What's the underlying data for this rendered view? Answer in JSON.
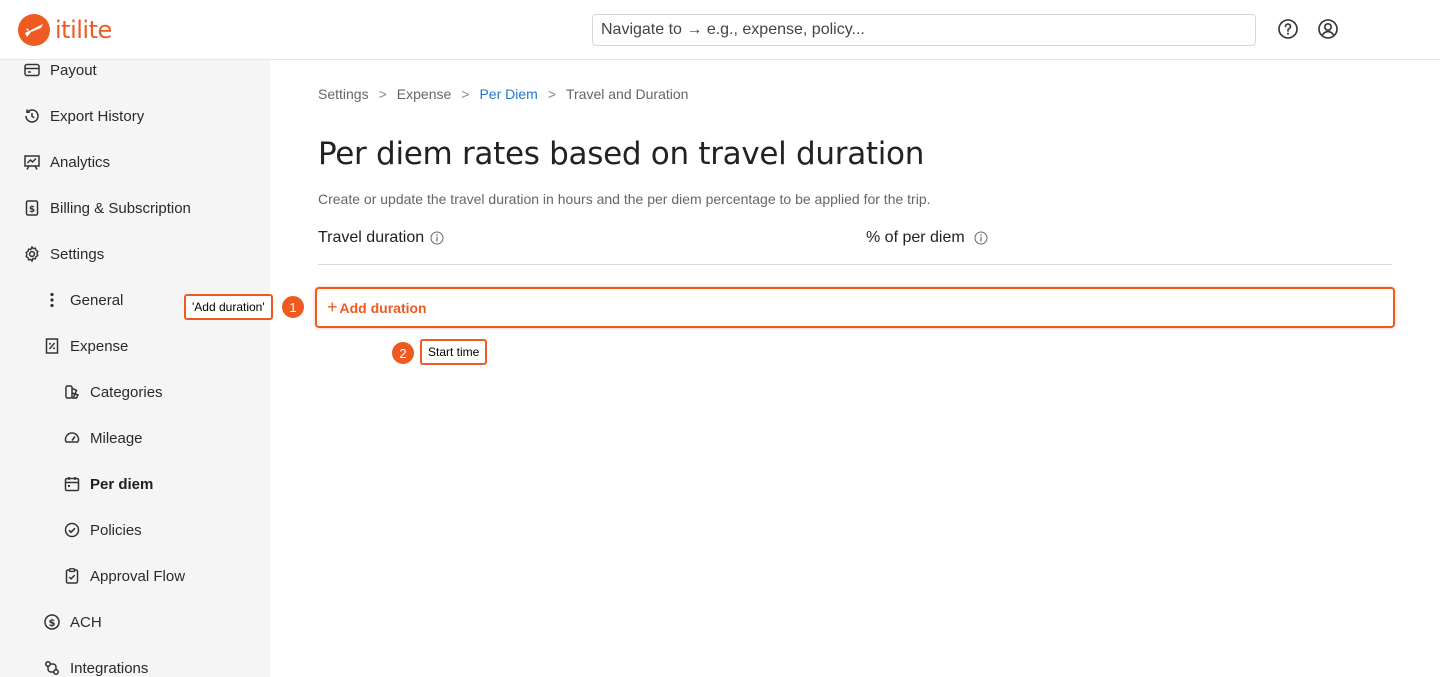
{
  "brand": {
    "name": "itilite",
    "color": "#ef5a22"
  },
  "search": {
    "placeholder": "Navigate to → e.g., expense, policy..."
  },
  "topbar": {
    "help_icon": "help-circle-icon",
    "user_icon": "user-circle-icon"
  },
  "sidebar": {
    "items": [
      {
        "label": "Payout",
        "icon": "card-icon"
      },
      {
        "label": "Export History",
        "icon": "history-icon"
      },
      {
        "label": "Analytics",
        "icon": "chart-board-icon"
      },
      {
        "label": "Billing & Subscription",
        "icon": "invoice-icon"
      },
      {
        "label": "Settings",
        "icon": "gear-icon"
      },
      {
        "label": "General",
        "icon": "more-vertical-icon"
      },
      {
        "label": "Expense",
        "icon": "receipt-percent-icon"
      },
      {
        "label": "Categories",
        "icon": "categories-icon"
      },
      {
        "label": "Mileage",
        "icon": "speedometer-icon"
      },
      {
        "label": "Per diem",
        "icon": "calendar-icon",
        "active": true
      },
      {
        "label": "Policies",
        "icon": "check-circle-icon"
      },
      {
        "label": "Approval Flow",
        "icon": "clipboard-check-icon"
      },
      {
        "label": "ACH",
        "icon": "dollar-circle-icon"
      },
      {
        "label": "Integrations",
        "icon": "integrations-icon"
      }
    ]
  },
  "breadcrumb": {
    "items": [
      "Settings",
      "Expense",
      "Per Diem",
      "Travel and Duration"
    ],
    "separator": ">"
  },
  "main": {
    "title": "Per diem rates based on travel duration",
    "subtitle": "Create or update the travel duration in hours and the per diem percentage to be applied for the trip.",
    "columns": [
      "Travel duration",
      "% of per diem"
    ],
    "add_button": {
      "plus": "+",
      "label": "Add duration"
    }
  },
  "annotations": [
    {
      "number": "1",
      "label": "'Add duration'"
    },
    {
      "number": "2",
      "label": "Start time"
    }
  ]
}
